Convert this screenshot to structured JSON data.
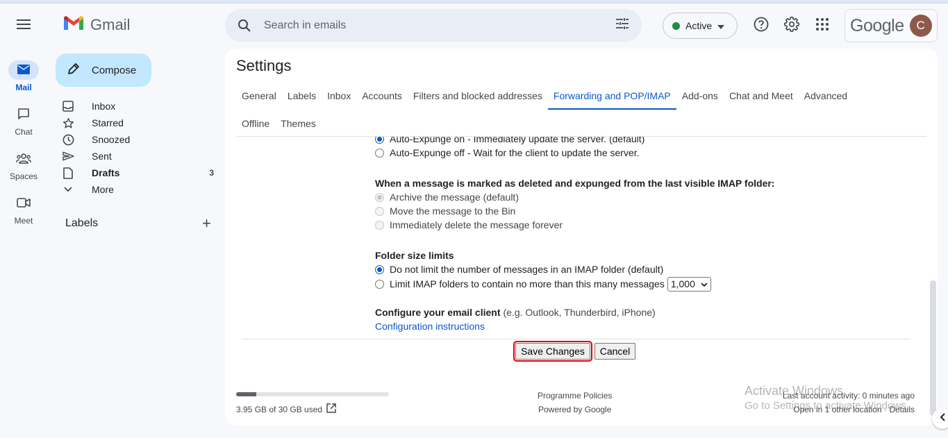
{
  "rail": {
    "items": [
      {
        "label": "Mail"
      },
      {
        "label": "Chat"
      },
      {
        "label": "Spaces"
      },
      {
        "label": "Meet"
      }
    ]
  },
  "brand": {
    "name": "Gmail"
  },
  "compose": {
    "label": "Compose"
  },
  "nav": [
    {
      "label": "Inbox",
      "icon": "inbox-icon"
    },
    {
      "label": "Starred",
      "icon": "star-icon"
    },
    {
      "label": "Snoozed",
      "icon": "clock-icon"
    },
    {
      "label": "Sent",
      "icon": "send-icon"
    },
    {
      "label": "Drafts",
      "icon": "draft-icon",
      "count": "3"
    },
    {
      "label": "More",
      "icon": "chevron-down-icon"
    }
  ],
  "labels": {
    "title": "Labels"
  },
  "search": {
    "placeholder": "Search in emails"
  },
  "status": {
    "label": "Active",
    "color": "#1e8e3e"
  },
  "account": {
    "brand": "Google",
    "initial": "C"
  },
  "settings": {
    "title": "Settings",
    "tabs": [
      "General",
      "Labels",
      "Inbox",
      "Accounts",
      "Filters and blocked addresses",
      "Forwarding and POP/IMAP",
      "Add-ons",
      "Chat and Meet",
      "Advanced",
      "Offline",
      "Themes"
    ],
    "active_tab": "Forwarding and POP/IMAP"
  },
  "expunge": {
    "on_label": "Auto-Expunge on - Immediately update the server. (default)",
    "off_label": "Auto-Expunge off - Wait for the client to update the server."
  },
  "deleted": {
    "title": "When a message is marked as deleted and expunged from the last visible IMAP folder:",
    "options": [
      "Archive the message (default)",
      "Move the message to the Bin",
      "Immediately delete the message forever"
    ]
  },
  "folder_limits": {
    "title": "Folder size limits",
    "no_limit": "Do not limit the number of messages in an IMAP folder (default)",
    "limit": "Limit IMAP folders to contain no more than this many messages",
    "limit_value": "1,000"
  },
  "client": {
    "title": "Configure your email client",
    "hint": "(e.g. Outlook, Thunderbird, iPhone)",
    "link": "Configuration instructions"
  },
  "buttons": {
    "save": "Save Changes",
    "cancel": "Cancel"
  },
  "footer": {
    "storage": "3.95 GB of 30 GB used",
    "storage_fraction": 0.13,
    "policies": "Programme Policies",
    "powered": "Powered by Google",
    "last_activity": "Last account activity: 0 minutes ago",
    "other_location": "Open in 1 other location · Details"
  },
  "watermark": {
    "line1": "Activate Windows",
    "line2": "Go to Settings to activate Windows."
  }
}
